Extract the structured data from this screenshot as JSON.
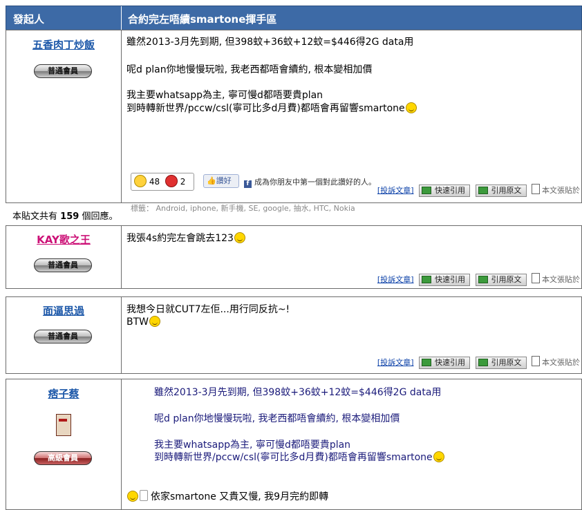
{
  "header": {
    "col_author": "發起人",
    "col_title": "合約完左唔續smartone揮手區"
  },
  "reply_count": {
    "prefix": "本貼文共有",
    "count": "159",
    "suffix": "個回應。"
  },
  "actions": {
    "report": "[投訴文章]",
    "quick_quote": "快速引用",
    "quote_original": "引用原文",
    "print": "本文張貼於"
  },
  "posts": [
    {
      "username": "五香肉丁炒飯",
      "username_color": "#1a56a8",
      "badge": "普通會員",
      "lines": [
        "雖然2013-3月先到期, 但398蚊+36蚊+12蚊=$446得2G data用",
        "呢d plan你地慢慢玩啦, 我老西都唔會續約, 根本變相加價",
        "我主要whatsapp為主, 寧可慢d都唔要貴plan",
        "到時轉新世界/pccw/csl(寧可比多d月費)都唔會再留響smartone"
      ],
      "rating_up": "48",
      "rating_down": "2",
      "like_label": "讚好",
      "fb_text": "成為你朋友中第一個對此讚好的人。",
      "tags": "標籤： Android, iphone, 新手機, SE, google, 抽水, HTC, Nokia"
    },
    {
      "username": "KAY歌之王",
      "username_color": "#cc1177",
      "badge": "普通會員",
      "lines": [
        "我張4s約完左會跳去123"
      ]
    },
    {
      "username": "面逼思過",
      "username_color": "#1a56a8",
      "badge": "普通會員",
      "lines": [
        "我想今日就CUT7左佢...用行同反抗~!",
        "BTW"
      ]
    },
    {
      "username": "痞子蔡",
      "username_color": "#1a56a8",
      "badge": "高級會員",
      "quote_lines": [
        "雖然2013-3月先到期, 但398蚊+36蚊+12蚊=$446得2G data用",
        "呢d plan你地慢慢玩啦, 我老西都唔會續約, 根本變相加價",
        "我主要whatsapp為主, 寧可慢d都唔要貴plan",
        "到時轉新世界/pccw/csl(寧可比多d月費)都唔會再留響smartone"
      ],
      "reply": "依家smartone 又貴又慢, 我9月完約即轉"
    }
  ],
  "colors": {
    "header_bg": "#3d6aa6",
    "link": "#1a56a8",
    "quote": "#1a1a7a"
  }
}
